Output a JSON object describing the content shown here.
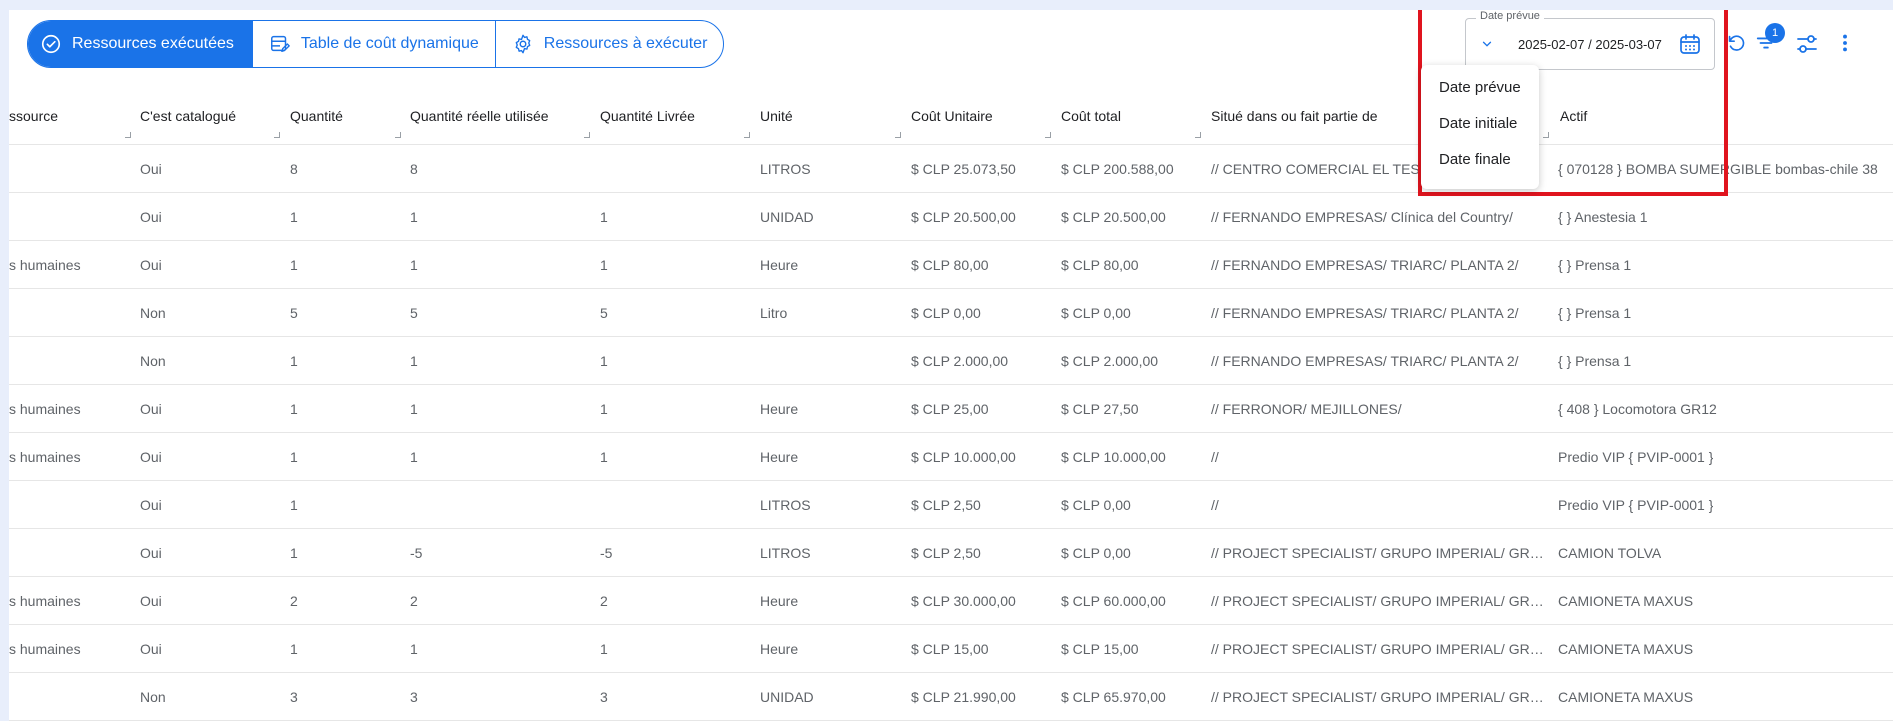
{
  "tabs": [
    {
      "label": "Ressources exécutées",
      "icon": "check-circle-icon",
      "active": true
    },
    {
      "label": "Table de coût dynamique",
      "icon": "table-edit-icon",
      "active": false
    },
    {
      "label": "Ressources à exécuter",
      "icon": "gear-icon",
      "active": false
    }
  ],
  "date_filter": {
    "label": "Date prévue",
    "value": "2025-02-07 / 2025-03-07",
    "options": [
      "Date prévue",
      "Date initiale",
      "Date finale"
    ]
  },
  "toolbar": {
    "filter_badge": "1",
    "icons": [
      "refresh-icon",
      "filter-icon",
      "sliders-icon",
      "more-vert-icon"
    ]
  },
  "colors": {
    "accent": "#1a73e8",
    "highlight": "#e0141e"
  },
  "table": {
    "columns": [
      "ssource",
      "C'est catalogué",
      "Quantité",
      "Quantité réelle utilisée",
      "Quantité Livrée",
      "Unité",
      "Coût Unitaire",
      "Coût total",
      "Situé dans ou fait partie de",
      "Actif"
    ],
    "rows": [
      [
        "",
        "Oui",
        "8",
        "8",
        "",
        "LITROS",
        "$ CLP 25.073,50",
        "$ CLP 200.588,00",
        "// CENTRO COMERCIAL EL TESO",
        "{ 070128 } BOMBA SUMERGIBLE bombas-chile 38"
      ],
      [
        "",
        "Oui",
        "1",
        "1",
        "1",
        "UNIDAD",
        "$ CLP 20.500,00",
        "$ CLP 20.500,00",
        "// FERNANDO EMPRESAS/ Clínica del Country/",
        "{ } Anestesia 1"
      ],
      [
        "s humaines",
        "Oui",
        "1",
        "1",
        "1",
        "Heure",
        "$ CLP 80,00",
        "$ CLP 80,00",
        "// FERNANDO EMPRESAS/ TRIARC/ PLANTA 2/",
        "{ } Prensa 1"
      ],
      [
        "",
        "Non",
        "5",
        "5",
        "5",
        "Litro",
        "$ CLP 0,00",
        "$ CLP 0,00",
        "// FERNANDO EMPRESAS/ TRIARC/ PLANTA 2/",
        "{ } Prensa 1"
      ],
      [
        "",
        "Non",
        "1",
        "1",
        "1",
        "",
        "$ CLP 2.000,00",
        "$ CLP 2.000,00",
        "// FERNANDO EMPRESAS/ TRIARC/ PLANTA 2/",
        "{ } Prensa 1"
      ],
      [
        "s humaines",
        "Oui",
        "1",
        "1",
        "1",
        "Heure",
        "$ CLP 25,00",
        "$ CLP 27,50",
        "// FERRONOR/ MEJILLONES/",
        "{ 408 } Locomotora GR12"
      ],
      [
        "s humaines",
        "Oui",
        "1",
        "1",
        "1",
        "Heure",
        "$ CLP 10.000,00",
        "$ CLP 10.000,00",
        "//",
        "Predio VIP { PVIP-0001 }"
      ],
      [
        "",
        "Oui",
        "1",
        "",
        "",
        "LITROS",
        "$ CLP 2,50",
        "$ CLP 0,00",
        "//",
        "Predio VIP { PVIP-0001 }"
      ],
      [
        "",
        "Oui",
        "1",
        "-5",
        "-5",
        "LITROS",
        "$ CLP 2,50",
        "$ CLP 0,00",
        "// PROJECT SPECIALIST/ GRUPO IMPERIAL/ GRUPO IMPERIAL",
        "CAMION TOLVA"
      ],
      [
        "s humaines",
        "Oui",
        "2",
        "2",
        "2",
        "Heure",
        "$ CLP 30.000,00",
        "$ CLP 60.000,00",
        "// PROJECT SPECIALIST/ GRUPO IMPERIAL/ GRUPO IMPERIAL",
        "CAMIONETA MAXUS"
      ],
      [
        "s humaines",
        "Oui",
        "1",
        "1",
        "1",
        "Heure",
        "$ CLP 15,00",
        "$ CLP 15,00",
        "// PROJECT SPECIALIST/ GRUPO IMPERIAL/ GRUPO IMPERIAL",
        "CAMIONETA MAXUS"
      ],
      [
        "",
        "Non",
        "3",
        "3",
        "3",
        "UNIDAD",
        "$ CLP 21.990,00",
        "$ CLP 65.970,00",
        "// PROJECT SPECIALIST/ GRUPO IMPERIAL/ GRUPO IMPERIAL",
        "CAMIONETA MAXUS"
      ]
    ]
  }
}
